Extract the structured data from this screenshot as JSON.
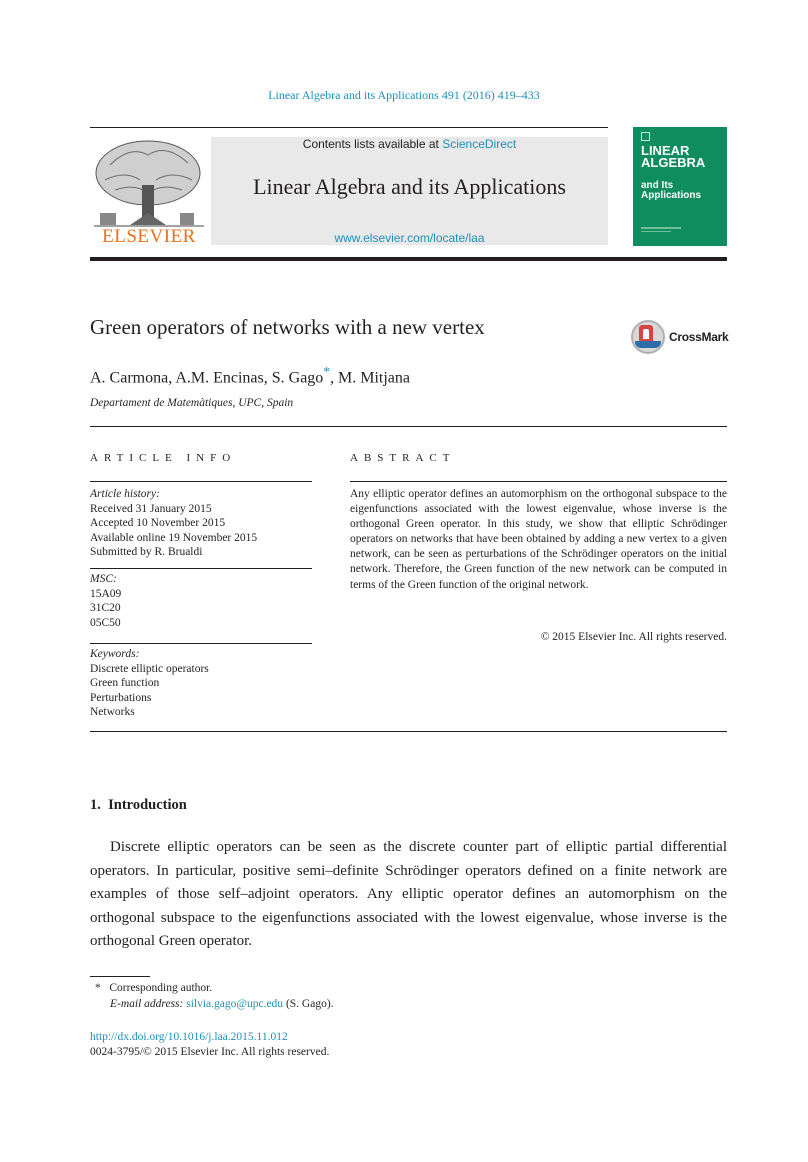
{
  "running_head": "Linear Algebra and its Applications 491 (2016) 419–433",
  "header": {
    "publisher_logo_text": "ELSEVIER",
    "contents_prefix": "Contents lists available at ",
    "contents_link": "ScienceDirect",
    "journal_title": "Linear Algebra and its Applications",
    "journal_url": "www.elsevier.com/locate/laa",
    "cover": {
      "title_line1": "LINEAR",
      "title_line2": "ALGEBRA",
      "sub_line1": "and Its",
      "sub_line2": "Applications"
    }
  },
  "article": {
    "title": "Green operators of networks with a new vertex",
    "crossmark_label": "CrossMark",
    "authors_before_star": "A. Carmona, A.M. Encinas, S. Gago",
    "author_star": "*",
    "authors_after_star": ", M. Mitjana",
    "affiliation": "Departament de Matemàtiques, UPC, Spain"
  },
  "article_info": {
    "heading": "ARTICLE INFO",
    "history_label": "Article history:",
    "history": [
      "Received 31 January 2015",
      "Accepted 10 November 2015",
      "Available online 19 November 2015",
      "Submitted by R. Brualdi"
    ],
    "msc_label": "MSC:",
    "msc": [
      "15A09",
      "31C20",
      "05C50"
    ],
    "keywords_label": "Keywords:",
    "keywords": [
      "Discrete elliptic operators",
      "Green function",
      "Perturbations",
      "Networks"
    ]
  },
  "abstract": {
    "heading": "ABSTRACT",
    "body": "Any elliptic operator defines an automorphism on the orthogonal subspace to the eigenfunctions associated with the lowest eigenvalue, whose inverse is the orthogonal Green operator. In this study, we show that elliptic Schrödinger operators on networks that have been obtained by adding a new vertex to a given network, can be seen as perturbations of the Schrödinger operators on the initial network. Therefore, the Green function of the new network can be computed in terms of the Green function of the original network.",
    "copyright": "© 2015 Elsevier Inc. All rights reserved."
  },
  "introduction": {
    "heading": "1.  Introduction",
    "paragraph": "Discrete elliptic operators can be seen as the discrete counter part of elliptic partial differential operators. In particular, positive semi–definite Schrödinger operators defined on a finite network are examples of those self–adjoint operators. Any elliptic operator defines an automorphism on the orthogonal subspace to the eigenfunctions associated with the lowest eigenvalue, whose inverse is the orthogonal Green operator."
  },
  "footnotes": {
    "star": "*",
    "corresponding": "Corresponding author.",
    "email_label": "E-mail address:",
    "email": "silvia.gago@upc.edu",
    "email_owner": "(S. Gago)."
  },
  "footer": {
    "doi": "http://dx.doi.org/10.1016/j.laa.2015.11.012",
    "issn": "0024-3795/© 2015 Elsevier Inc. All rights reserved."
  }
}
